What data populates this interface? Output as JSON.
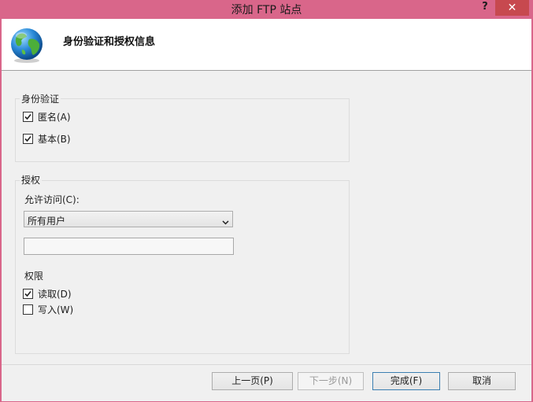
{
  "window": {
    "title": "添加 FTP 站点",
    "help_label": "?",
    "close_label": "✕"
  },
  "header": {
    "title": "身份验证和授权信息",
    "icon": "globe-icon"
  },
  "authentication": {
    "legend": "身份验证",
    "anonymous": {
      "label": "匿名(A)",
      "checked": true
    },
    "basic": {
      "label": "基本(B)",
      "checked": true
    }
  },
  "authorization": {
    "legend": "授权",
    "allow_access_label": "允许访问(C):",
    "allow_access_value": "所有用户",
    "user_input_value": "",
    "permissions_label": "权限",
    "read": {
      "label": "读取(D)",
      "checked": true
    },
    "write": {
      "label": "写入(W)",
      "checked": false
    }
  },
  "footer": {
    "previous_label": "上一页(P)",
    "next_label": "下一步(N)",
    "finish_label": "完成(F)",
    "cancel_label": "取消"
  },
  "colors": {
    "window_frame": "#d9668a",
    "close_button": "#c7494f",
    "dialog_background": "#f0f0f0",
    "header_background": "#ffffff"
  }
}
